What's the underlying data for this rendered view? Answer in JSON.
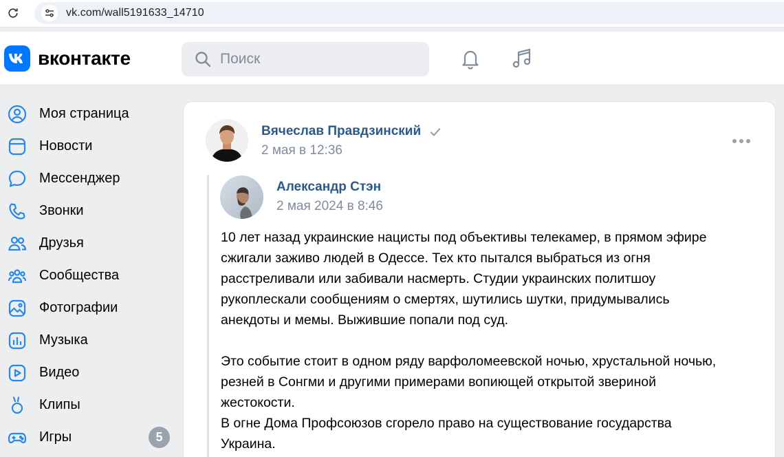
{
  "browser": {
    "url": "vk.com/wall5191633_14710"
  },
  "header": {
    "logo_text": "вконтакте",
    "search_placeholder": "Поиск"
  },
  "sidebar": {
    "items": [
      {
        "label": "Моя страница",
        "icon": "user-circle-icon"
      },
      {
        "label": "Новости",
        "icon": "news-icon"
      },
      {
        "label": "Мессенджер",
        "icon": "chat-bubble-icon"
      },
      {
        "label": "Звонки",
        "icon": "phone-icon"
      },
      {
        "label": "Друзья",
        "icon": "friends-icon"
      },
      {
        "label": "Сообщества",
        "icon": "communities-icon"
      },
      {
        "label": "Фотографии",
        "icon": "photo-icon"
      },
      {
        "label": "Музыка",
        "icon": "music-icon"
      },
      {
        "label": "Видео",
        "icon": "video-icon"
      },
      {
        "label": "Клипы",
        "icon": "clips-icon"
      },
      {
        "label": "Игры",
        "icon": "gamepad-icon",
        "badge": "5"
      }
    ]
  },
  "post": {
    "author": "Вячеслав Правдзинский",
    "date": "2 мая в 12:36",
    "repost": {
      "author": "Александр Стэн",
      "date": "2 мая 2024 в 8:46",
      "text": "10 лет назад украинские нацисты под объективы телекамер, в прямом эфире\nсжигали заживо людей в Одессе. Тех кто пытался выбраться из огня\nрасстреливали или забивали насмерть. Студии украинских политшоу\nрукоплескали сообщениям о смертях, шутились шутки, придумывались\nанекдоты и мемы. Выжившие попали под суд.\n\nЭто событие стоит в одном ряду варфоломеевской ночью, хрустальной ночью,\nрезней в Сонгми и другими примерами вопиющей открытой звериной\nжестокости.\nВ огне Дома Профсоюзов сгорело право на существование государства\nУкраина."
    }
  },
  "colors": {
    "accent": "#0077ff",
    "link": "#2c5987",
    "secondary_text": "#818c99",
    "icon": "#2688eb"
  }
}
